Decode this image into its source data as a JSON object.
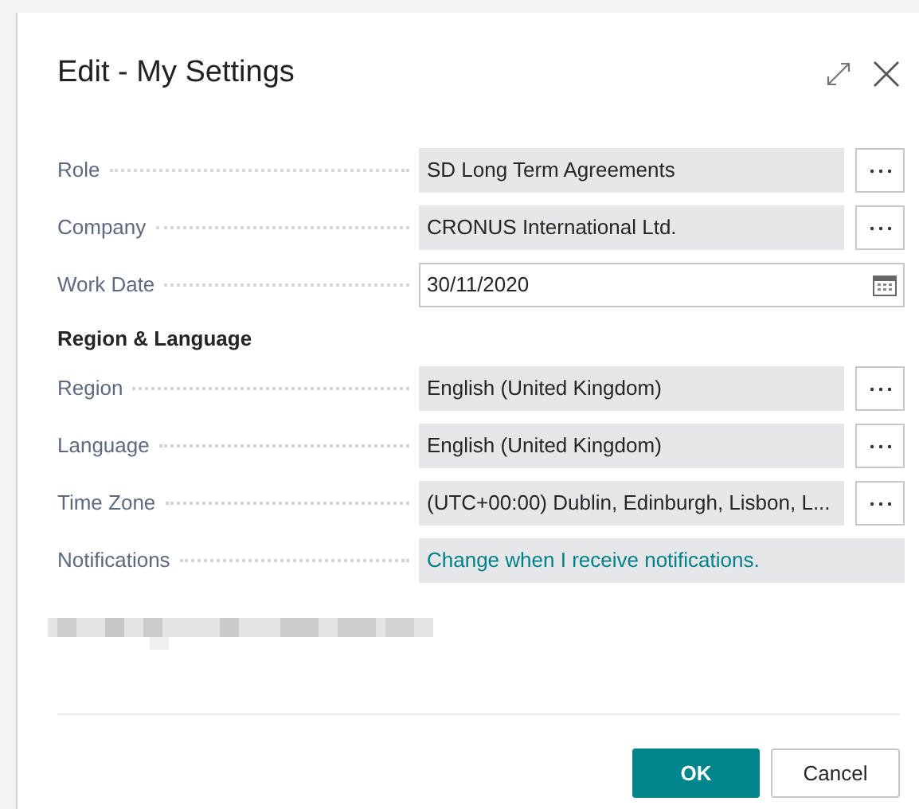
{
  "dialog": {
    "title": "Edit - My Settings"
  },
  "fields": [
    {
      "label": "Role",
      "value": "SD Long Term Agreements",
      "kind": "lookup"
    },
    {
      "label": "Company",
      "value": "CRONUS International Ltd.",
      "kind": "lookup"
    },
    {
      "label": "Work Date",
      "value": "30/11/2020",
      "kind": "date"
    }
  ],
  "section": {
    "title": "Region & Language",
    "fields": [
      {
        "label": "Region",
        "value": "English (United Kingdom)",
        "kind": "lookup"
      },
      {
        "label": "Language",
        "value": "English (United Kingdom)",
        "kind": "lookup"
      },
      {
        "label": "Time Zone",
        "value": "(UTC+00:00) Dublin, Edinburgh, Lisbon, L...",
        "kind": "lookup"
      },
      {
        "label": "Notifications",
        "value": "Change when I receive notifications.",
        "kind": "link"
      }
    ]
  },
  "buttons": [
    {
      "label": "OK",
      "kind": "primary"
    },
    {
      "label": "Cancel",
      "kind": "secondary"
    }
  ]
}
